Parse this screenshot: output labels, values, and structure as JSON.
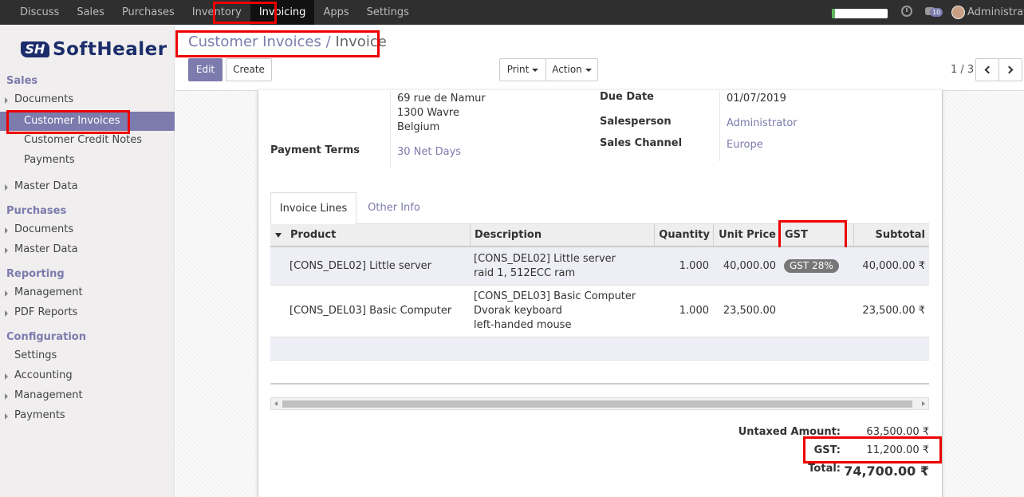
{
  "topbar": {
    "menu": [
      "Discuss",
      "Sales",
      "Purchases",
      "Inventory",
      "Invoicing",
      "Apps",
      "Settings"
    ],
    "active": "Invoicing",
    "progress_percent": 95,
    "chat_count": "10",
    "user": "Administrator"
  },
  "sidebar": {
    "logo_mark": "SH",
    "logo_text": "SoftHealer",
    "sections": {
      "sales": "Sales",
      "purchases": "Purchases",
      "reporting": "Reporting",
      "configuration": "Configuration"
    },
    "items": {
      "sales_documents": "Documents",
      "customer_invoices": "Customer Invoices",
      "customer_credit_notes": "Customer Credit Notes",
      "payments": "Payments",
      "sales_master_data": "Master Data",
      "purch_documents": "Documents",
      "purch_master_data": "Master Data",
      "management": "Management",
      "pdf_reports": "PDF Reports",
      "settings": "Settings",
      "accounting": "Accounting",
      "config_management": "Management",
      "config_payments": "Payments"
    }
  },
  "breadcrumb": {
    "parent": "Customer Invoices",
    "sep": "/",
    "current": "Invoice"
  },
  "buttons": {
    "edit": "Edit",
    "create": "Create",
    "print": "Print",
    "action": "Action"
  },
  "pager": "1 / 3",
  "form": {
    "address": [
      "69 rue de Namur",
      "1300 Wavre",
      "Belgium"
    ],
    "payment_terms_label": "Payment Terms",
    "payment_terms": "30 Net Days",
    "due_date_label": "Due Date",
    "due_date": "01/07/2019",
    "salesperson_label": "Salesperson",
    "salesperson": "Administrator",
    "sales_channel_label": "Sales Channel",
    "sales_channel": "Europe"
  },
  "tabs": [
    "Invoice Lines",
    "Other Info"
  ],
  "table": {
    "headers": {
      "product": "Product",
      "description": "Description",
      "quantity": "Quantity",
      "unit_price": "Unit Price",
      "gst": "GST",
      "subtotal": "Subtotal"
    },
    "rows": [
      {
        "product": "[CONS_DEL02] Little server",
        "description": [
          "[CONS_DEL02] Little server",
          "raid 1, 512ECC ram"
        ],
        "quantity": "1.000",
        "unit_price": "40,000.00",
        "gst": "GST 28%",
        "subtotal": "40,000.00 ₹"
      },
      {
        "product": "[CONS_DEL03] Basic Computer",
        "description": [
          "[CONS_DEL03] Basic Computer",
          "Dvorak keyboard",
          "left-handed mouse"
        ],
        "quantity": "1.000",
        "unit_price": "23,500.00",
        "gst": "",
        "subtotal": "23,500.00 ₹"
      }
    ]
  },
  "totals": {
    "untaxed_label": "Untaxed Amount:",
    "untaxed": "63,500.00 ₹",
    "gst_label": "GST:",
    "gst": "11,200.00 ₹",
    "total_label": "Total:",
    "total": "74,700.00 ₹"
  }
}
